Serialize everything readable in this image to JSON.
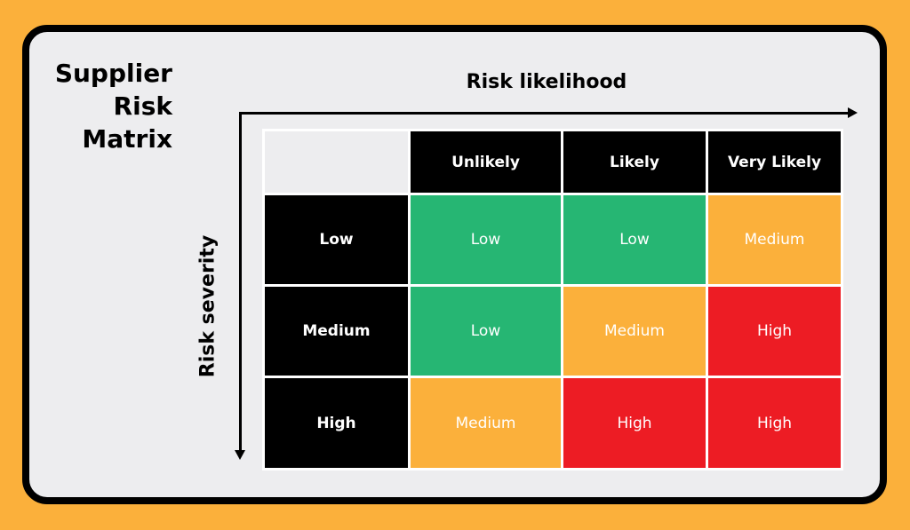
{
  "title": [
    "Supplier",
    "Risk",
    "Matrix"
  ],
  "x_axis_label": "Risk likelihood",
  "y_axis_label": "Risk severity",
  "columns": [
    "Unlikely",
    "Likely",
    "Very Likely"
  ],
  "rows": [
    {
      "label": "Low",
      "cells": [
        "Low",
        "Low",
        "Medium"
      ]
    },
    {
      "label": "Medium",
      "cells": [
        "Low",
        "Medium",
        "High"
      ]
    },
    {
      "label": "High",
      "cells": [
        "Medium",
        "High",
        "High"
      ]
    }
  ],
  "colors": {
    "Low": "#26b673",
    "Medium": "#fbb03b",
    "High": "#ed1c24",
    "background": "#fbb03b",
    "card": "#ededef"
  }
}
